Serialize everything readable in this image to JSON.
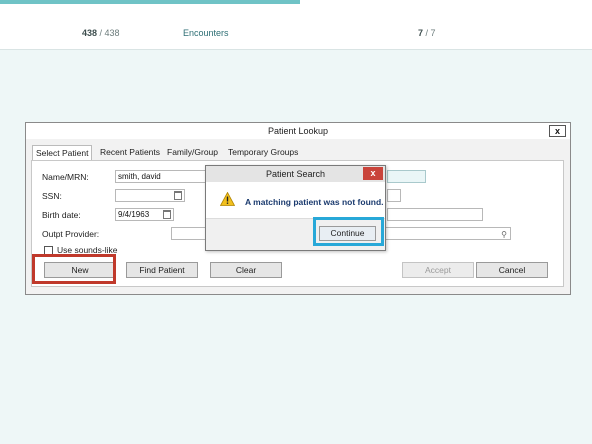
{
  "topbar": {
    "accent_color": "#6fc3c6",
    "pages_current": "438",
    "pages_sep": " / ",
    "pages_total": "438",
    "section_label": "Encounters",
    "step_current": "7",
    "step_sep": " / ",
    "step_total": "7"
  },
  "lookup": {
    "title": "Patient Lookup",
    "close_label": "x",
    "tabs": [
      {
        "label": "Select Patient"
      },
      {
        "label": "Recent Patients"
      },
      {
        "label": "Family/Group"
      },
      {
        "label": "Temporary Groups"
      }
    ],
    "fields": {
      "name_label": "Name/MRN:",
      "name_value": "smith, david",
      "ssn_label": "SSN:",
      "ssn_value": "",
      "birth_label": "Birth date:",
      "birth_value": "9/4/1963",
      "provider_label": "Outpt Provider:",
      "provider_value": ""
    },
    "sounds_like_label": "Use sounds-like",
    "sounds_like_checked": false,
    "buttons": {
      "new": "New",
      "find": "Find Patient",
      "clear": "Clear",
      "accept": "Accept",
      "cancel": "Cancel"
    }
  },
  "search_dialog": {
    "title": "Patient Search",
    "close_label": "x",
    "message": "A matching patient was not found.",
    "continue_label": "Continue",
    "icon": "warning-icon"
  },
  "highlights": {
    "red": "#c0392b",
    "blue": "#28a8d8"
  }
}
